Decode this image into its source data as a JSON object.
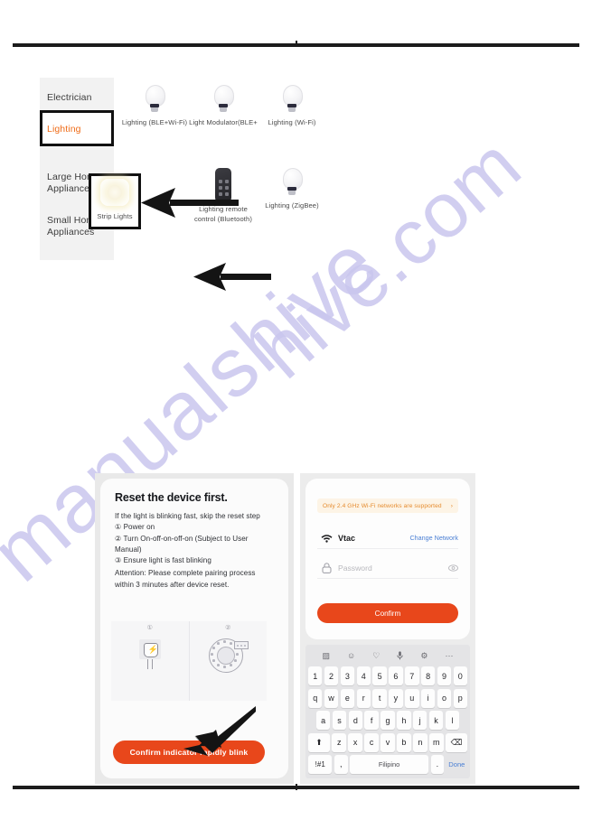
{
  "device_picker": {
    "categories": [
      {
        "label": "Electrician",
        "selected": false
      },
      {
        "label": "Lighting",
        "selected": true
      },
      {
        "label": "Large Home Appliances",
        "selected": false
      },
      {
        "label": "Small Home Appliances",
        "selected": false
      }
    ],
    "devices": [
      {
        "label": "Lighting (BLE+Wi-Fi)",
        "icon": "bulb-icon",
        "highlighted": false
      },
      {
        "label": "Light Modulator(BLE+",
        "icon": "bulb-icon",
        "highlighted": false
      },
      {
        "label": "Lighting (Wi-Fi)",
        "icon": "bulb-icon",
        "highlighted": false
      },
      {
        "label": "Strip Lights",
        "icon": "strip-light-icon",
        "highlighted": true
      },
      {
        "label": "Lighting remote control (Bluetooth)",
        "icon": "remote-control-icon",
        "highlighted": false
      },
      {
        "label": "Lighting (ZigBee)",
        "icon": "bulb-icon",
        "highlighted": false
      }
    ]
  },
  "reset_screen": {
    "title": "Reset the device first.",
    "intro": "If the light is blinking fast, skip the reset step",
    "steps": [
      "①  Power on",
      "②  Turn On-off-on-off-on (Subject to User Manual)",
      "③  Ensure light is fast blinking"
    ],
    "attention": "Attention: Please complete pairing process within 3 minutes after device reset.",
    "figure_labels": [
      "①",
      "②"
    ],
    "confirm_button": "Confirm indicator rapidly blink"
  },
  "wifi_screen": {
    "banner": "Only 2.4 GHz Wi-Fi networks are supported",
    "banner_chevron": "›",
    "ssid": "Vtac",
    "change_network": "Change Network",
    "password_placeholder": "Password",
    "confirm_button": "Confirm"
  },
  "keyboard": {
    "toolbar_icons": [
      "sticker-icon",
      "emoji-icon",
      "gif-heart-icon",
      "microphone-icon",
      "gear-icon",
      "more-icon"
    ],
    "toolbar_glyphs": [
      "▨",
      "☺",
      "♡",
      "•",
      "⚙",
      "···"
    ],
    "row_numbers": [
      "1",
      "2",
      "3",
      "4",
      "5",
      "6",
      "7",
      "8",
      "9",
      "0"
    ],
    "row_top": [
      "q",
      "w",
      "e",
      "r",
      "t",
      "y",
      "u",
      "i",
      "o",
      "p"
    ],
    "row_mid": [
      "a",
      "s",
      "d",
      "f",
      "g",
      "h",
      "j",
      "k",
      "l"
    ],
    "row_bottom": [
      "z",
      "x",
      "c",
      "v",
      "b",
      "n",
      "m"
    ],
    "shift_key": "⬆",
    "backspace_key": "⌫",
    "symbols_key": "!#1",
    "comma_key": ",",
    "space_key": "Filipino",
    "period_key": ".",
    "done_key": "Done"
  },
  "watermark": {
    "line_a": "manualshive",
    "line_b": "hive.com"
  },
  "colors": {
    "accent_orange": "#ef6c18",
    "button_red": "#e8471b",
    "link_blue": "#4a7fd4",
    "banner_bg": "#fdf4e6",
    "watermark": "#c9c6ee"
  }
}
